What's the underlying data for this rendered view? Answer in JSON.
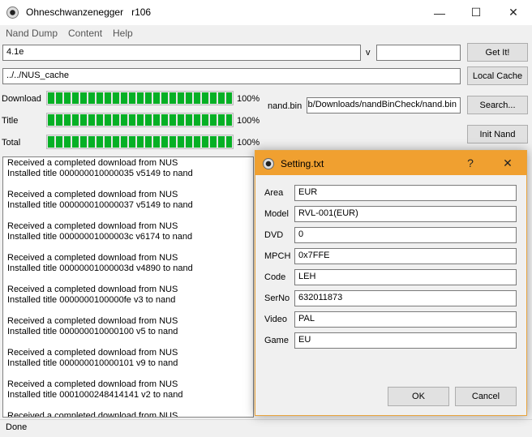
{
  "window": {
    "title": "Ohneschwanzenegger   r106",
    "minimize": "—",
    "maximize": "☐",
    "close": "✕"
  },
  "menu": [
    "Nand Dump",
    "Content",
    "Help"
  ],
  "top": {
    "version_value": "4.1e",
    "v_label": "v",
    "v_value": "",
    "get_button": "Get It!",
    "cache_path": "../../NUS_cache",
    "local_cache_button": "Local Cache",
    "nandbin_label": "nand.bin",
    "nandbin_path": "lib/Downloads/nandBinCheck/nand.bin",
    "search_button": "Search...",
    "init_button": "Init Nand"
  },
  "progress": [
    {
      "label": "Download",
      "percent_text": "100%",
      "value": 1.0
    },
    {
      "label": "Title",
      "percent_text": "100%",
      "value": 1.0
    },
    {
      "label": "Total",
      "percent_text": "100%",
      "value": 1.0
    }
  ],
  "log": [
    [
      "Received a completed download from NUS",
      "Installed title 000000010000035 v5149 to nand"
    ],
    [
      "Received a completed download from NUS",
      "Installed title 000000010000037 v5149 to nand"
    ],
    [
      "Received a completed download from NUS",
      "Installed title 00000001000003c v6174 to nand"
    ],
    [
      "Received a completed download from NUS",
      "Installed title 00000001000003d v4890 to nand"
    ],
    [
      "Received a completed download from NUS",
      "Installed title 0000000100000fe v3 to nand"
    ],
    [
      "Received a completed download from NUS",
      "Installed title 000000010000100 v5 to nand"
    ],
    [
      "Received a completed download from NUS",
      "Installed title 000000010000101 v9 to nand"
    ],
    [
      "Received a completed download from NUS",
      "Installed title 0001000248414141 v2 to nand"
    ],
    [
      "Received a completed download from NUS",
      ""
    ]
  ],
  "status": "Done",
  "dialog": {
    "title": "Setting.txt",
    "help": "?",
    "close": "✕",
    "fields": [
      {
        "label": "Area",
        "value": "EUR"
      },
      {
        "label": "Model",
        "value": "RVL-001(EUR)"
      },
      {
        "label": "DVD",
        "value": "0"
      },
      {
        "label": "MPCH",
        "value": "0x7FFE"
      },
      {
        "label": "Code",
        "value": "LEH"
      },
      {
        "label": "SerNo",
        "value": "632011873"
      },
      {
        "label": "Video",
        "value": "PAL"
      },
      {
        "label": "Game",
        "value": "EU"
      }
    ],
    "ok": "OK",
    "cancel": "Cancel"
  },
  "colors": {
    "progress_fill": "#06b025",
    "dialog_titlebar": "#f0a030"
  }
}
